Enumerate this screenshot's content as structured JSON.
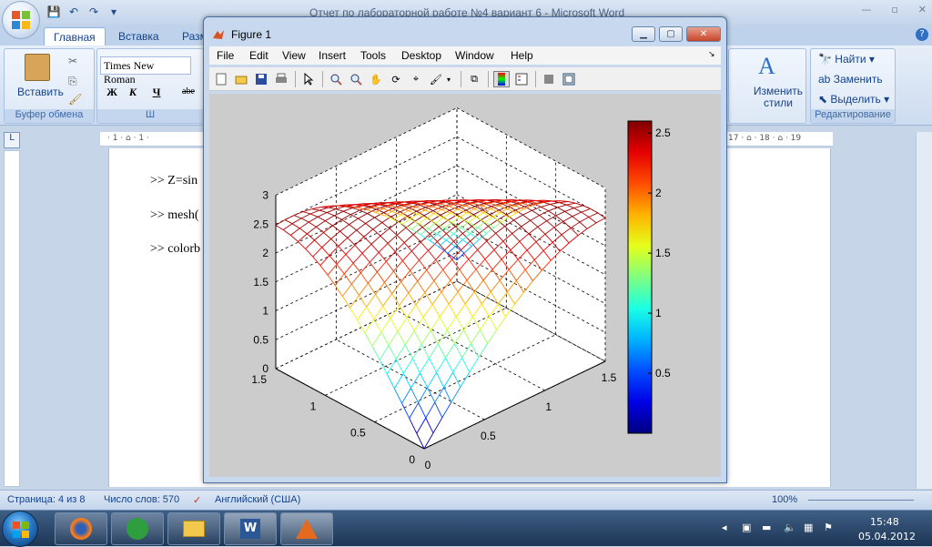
{
  "word": {
    "title": "Отчет по лабораторной работе №4 вариант 6  -  Microsoft Word",
    "tabs": [
      "Главная",
      "Вставка",
      "Разм"
    ],
    "ribbon": {
      "paste_label": "Вставить",
      "clipboard_group": "Буфер обмена",
      "font_name": "Times New Roman",
      "bold": "Ж",
      "italic": "К",
      "underline": "Ч",
      "strike": "abe",
      "partial_group_letter": "Ш",
      "styles_label": "Изменить стили",
      "find_label": "Найти",
      "replace_label": "Заменить",
      "select_label": "Выделить",
      "editing_group": "Редактирование"
    },
    "ruler_marks_left": "· 1 · ⌂ · 1 ·",
    "ruler_marks_right": "17 · ⌂ · 18 · ⌂ · 19",
    "doc_lines": [
      ">> Z=sin",
      ">> mesh(",
      ">> colorb"
    ],
    "status": {
      "page": "Страница: 4 из 8",
      "words": "Число слов: 570",
      "language": "Английский (США)",
      "zoom": "100%"
    }
  },
  "figure": {
    "title": "Figure 1",
    "menu": [
      "File",
      "Edit",
      "View",
      "Insert",
      "Tools",
      "Desktop",
      "Window",
      "Help"
    ],
    "chart_data": {
      "type": "mesh",
      "zlim": [
        0,
        3
      ],
      "xlim": [
        0,
        1.5
      ],
      "ylim": [
        0,
        1.5
      ],
      "z_ticks": [
        "0",
        "0.5",
        "1",
        "1.5",
        "2",
        "2.5",
        "3"
      ],
      "x_ticks": [
        "0",
        "0.5",
        "1",
        "1.5"
      ],
      "y_ticks": [
        "0",
        "0.5",
        "1",
        "1.5"
      ],
      "colorbar_ticks": [
        "0.5",
        "1",
        "1.5",
        "2",
        "2.5"
      ],
      "colorbar_range": [
        0,
        2.6
      ],
      "colormap": "jet"
    }
  },
  "taskbar": {
    "time": "15:48",
    "date": "05.04.2012"
  }
}
